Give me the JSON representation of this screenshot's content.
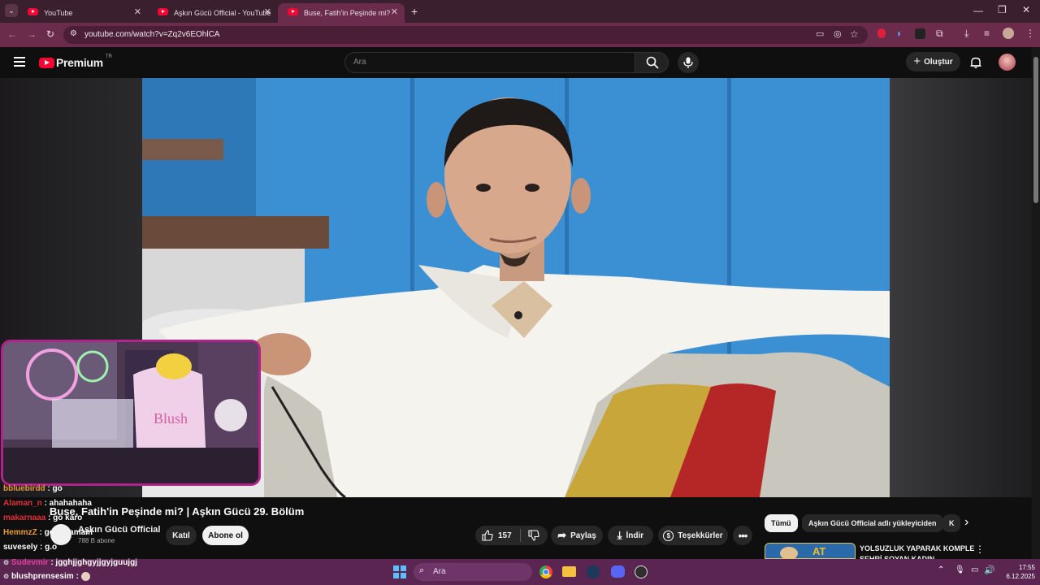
{
  "browser": {
    "tabs": [
      {
        "title": "YouTube"
      },
      {
        "title": "Aşkın Gücü Official - YouTube"
      },
      {
        "title": "Buse, Fatih'in Peşinde mi? | Aşk"
      }
    ],
    "url": "youtube.com/watch?v=Zq2v6EOhlCA"
  },
  "youtube": {
    "logo_text": "Premium",
    "logo_region": "TR",
    "search_placeholder": "Ara",
    "create_label": "Oluştur"
  },
  "chat": [
    {
      "user": "bbluebirdd",
      "msg": ": go",
      "color": "#e89a3a"
    },
    {
      "user": "Alaman_n",
      "msg": ": ahahahaha",
      "color": "#e0303a"
    },
    {
      "user": "makarnaaa",
      "msg": ": go karo",
      "color": "#e0303a"
    },
    {
      "user": "HemmzZ",
      "msg": ": go kuramam",
      "color": "#e89a3a"
    },
    {
      "user": "suvesely",
      "msg": ": g.o",
      "color": "#ffffff"
    },
    {
      "user": "Sudevmir",
      "msg": ": jgghjjghgyjjgyjguujgj",
      "color": "#e040a0"
    },
    {
      "user": "blushprensesim",
      "msg": ":",
      "color": "#ffffff"
    }
  ],
  "video": {
    "title": "Buse, Fatih'in Peşinde mi? | Aşkın Gücü 29. Bölüm",
    "channel": "Aşkın Gücü Official",
    "subscribers": "788 B abone",
    "join_label": "Katıl",
    "subscribe_label": "Abone ol",
    "likes": "157",
    "share_label": "Paylaş",
    "download_label": "İndir",
    "thanks_label": "Teşekkürler"
  },
  "sidebar": {
    "chips": [
      "Tümü",
      "Aşkın Gücü Official adlı yükleyiciden",
      "K"
    ],
    "rec_title_1": "YOLSUZLUK YAPARAK KOMPLE",
    "rec_title_2": "ŞEHRİ SOYAN KADIN"
  },
  "taskbar": {
    "search_placeholder": "Ara",
    "time": "17:55",
    "date": "6.12.2025"
  },
  "colors": {
    "accent": "#ff0033",
    "tab_bg": "#3a1f2e",
    "active_tab": "#6b2b4b",
    "taskbar": "#5a2550",
    "webcam_border": "#b0238a"
  }
}
